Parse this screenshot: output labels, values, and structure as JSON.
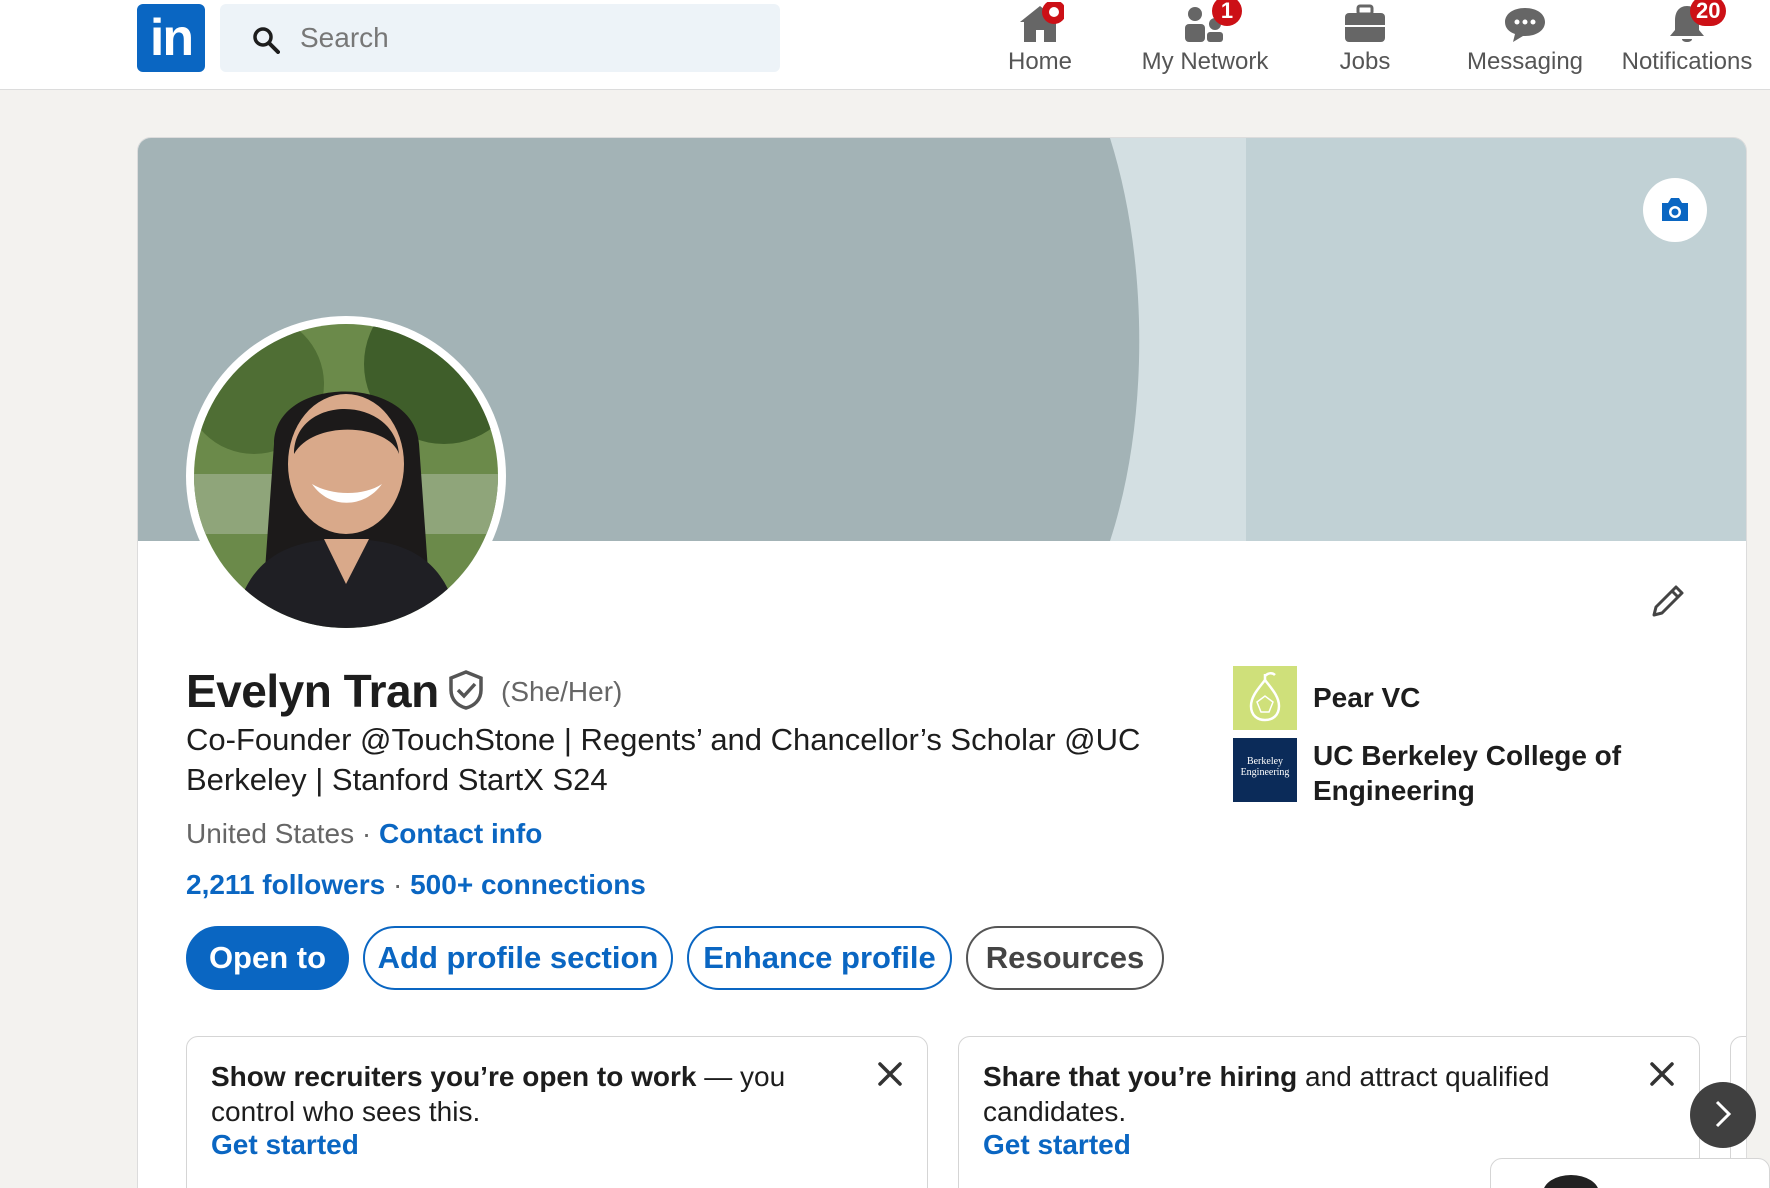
{
  "topbar": {
    "logo_text": "in",
    "search": {
      "placeholder": "Search"
    },
    "nav": [
      {
        "label": "Home",
        "icon": "home-icon",
        "badge": ""
      },
      {
        "label": "My Network",
        "icon": "network-icon",
        "badge": "1"
      },
      {
        "label": "Jobs",
        "icon": "briefcase-icon",
        "badge": ""
      },
      {
        "label": "Messaging",
        "icon": "message-icon",
        "badge": ""
      },
      {
        "label": "Notifications",
        "icon": "bell-icon",
        "badge": "20"
      }
    ]
  },
  "profile": {
    "name": "Evelyn Tran",
    "pronouns": "(She/Her)",
    "headline": "Co-Founder @TouchStone | Regents’ and Chancellor’s Scholar @UC Berkeley | Stanford StartX S24",
    "location": "United States",
    "separator": " · ",
    "contact_info": "Contact info",
    "followers": "2,211 followers",
    "stats_separator": " · ",
    "connections": "500+ connections",
    "buttons": {
      "open_to": "Open to",
      "add_section": "Add profile section",
      "enhance": "Enhance profile",
      "resources": "Resources"
    },
    "orgs": [
      {
        "name": "Pear VC",
        "logo_text": ""
      },
      {
        "name": "UC Berkeley College of Engineering",
        "logo_text": "Berkeley Engineering"
      }
    ]
  },
  "suggestions": [
    {
      "bold": "Show recruiters you’re open to work",
      "rest": " — you control who sees this.",
      "cta": "Get started"
    },
    {
      "bold": "Share that you’re hiring",
      "rest": " and attract qualified candidates.",
      "cta": "Get started"
    }
  ],
  "colors": {
    "brand": "#0a66c2",
    "badge": "#cc1016",
    "banner_dark": "#a3b3b6",
    "banner_light": "#c1d1d5"
  }
}
